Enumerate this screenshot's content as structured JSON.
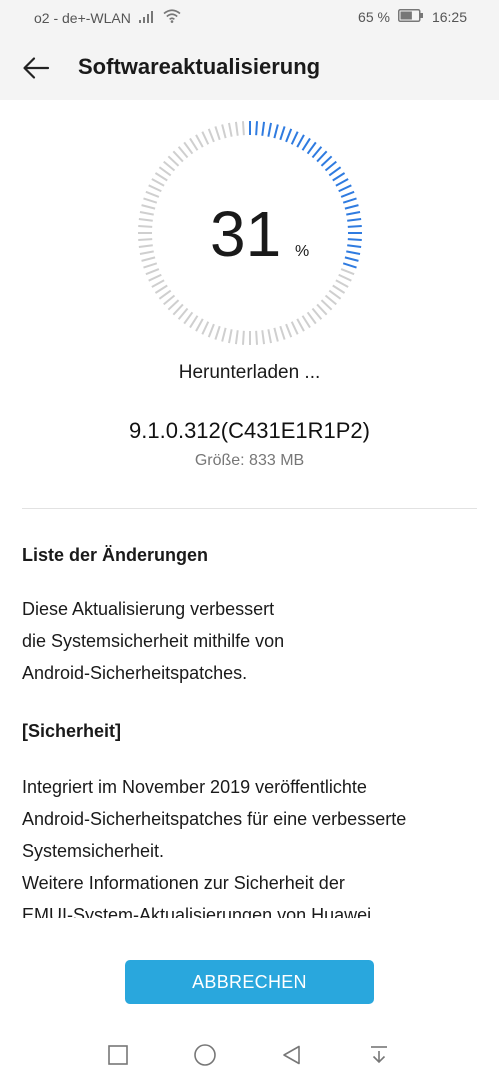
{
  "status_bar": {
    "carrier": "o2 - de+-WLAN",
    "battery_percent": "65 %",
    "battery_level": 0.65,
    "time": "16:25"
  },
  "header": {
    "title": "Softwareaktualisierung",
    "back_icon": "arrow-left-icon"
  },
  "progress": {
    "value": "31",
    "fraction": 0.31,
    "unit": "%",
    "status": "Herunterladen ...",
    "accent_color": "#2f7be0",
    "track_color": "#cfcfcf"
  },
  "update": {
    "version": "9.1.0.312(C431E1R1P2)",
    "size": "Größe: 833 MB"
  },
  "changelog": {
    "heading": "Liste der Änderungen",
    "intro_lines": [
      "Diese Aktualisierung verbessert",
      "die Systemsicherheit mithilfe von",
      "Android-Sicherheitspatches."
    ],
    "security_heading": "[Sicherheit]",
    "security_lines": [
      "Integriert im November 2019 veröffentlichte",
      "Android-Sicherheitspatches für eine verbesserte",
      "Systemsicherheit.",
      "Weitere Informationen zur Sicherheit der",
      "EMUI-System-Aktualisierungen von Huawei"
    ]
  },
  "actions": {
    "cancel_label": "ABBRECHEN",
    "button_color": "#29a7dd"
  },
  "nav_bar": {
    "recent_icon": "square-icon",
    "home_icon": "circle-icon",
    "back_icon": "triangle-back-icon",
    "notification_icon": "pull-down-icon"
  }
}
